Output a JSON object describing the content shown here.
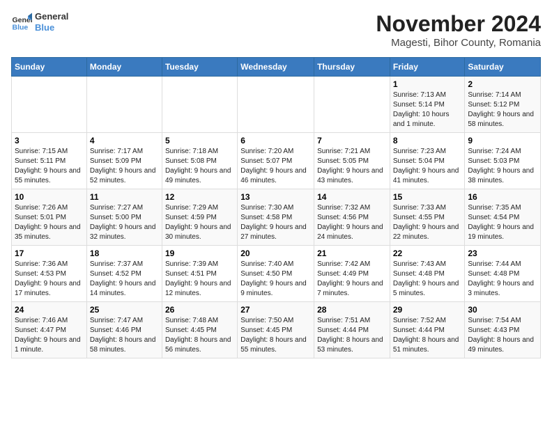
{
  "header": {
    "logo_line1": "General",
    "logo_line2": "Blue",
    "main_title": "November 2024",
    "subtitle": "Magesti, Bihor County, Romania"
  },
  "days_of_week": [
    "Sunday",
    "Monday",
    "Tuesday",
    "Wednesday",
    "Thursday",
    "Friday",
    "Saturday"
  ],
  "weeks": [
    [
      {
        "day": "",
        "info": ""
      },
      {
        "day": "",
        "info": ""
      },
      {
        "day": "",
        "info": ""
      },
      {
        "day": "",
        "info": ""
      },
      {
        "day": "",
        "info": ""
      },
      {
        "day": "1",
        "info": "Sunrise: 7:13 AM\nSunset: 5:14 PM\nDaylight: 10 hours and 1 minute."
      },
      {
        "day": "2",
        "info": "Sunrise: 7:14 AM\nSunset: 5:12 PM\nDaylight: 9 hours and 58 minutes."
      }
    ],
    [
      {
        "day": "3",
        "info": "Sunrise: 7:15 AM\nSunset: 5:11 PM\nDaylight: 9 hours and 55 minutes."
      },
      {
        "day": "4",
        "info": "Sunrise: 7:17 AM\nSunset: 5:09 PM\nDaylight: 9 hours and 52 minutes."
      },
      {
        "day": "5",
        "info": "Sunrise: 7:18 AM\nSunset: 5:08 PM\nDaylight: 9 hours and 49 minutes."
      },
      {
        "day": "6",
        "info": "Sunrise: 7:20 AM\nSunset: 5:07 PM\nDaylight: 9 hours and 46 minutes."
      },
      {
        "day": "7",
        "info": "Sunrise: 7:21 AM\nSunset: 5:05 PM\nDaylight: 9 hours and 43 minutes."
      },
      {
        "day": "8",
        "info": "Sunrise: 7:23 AM\nSunset: 5:04 PM\nDaylight: 9 hours and 41 minutes."
      },
      {
        "day": "9",
        "info": "Sunrise: 7:24 AM\nSunset: 5:03 PM\nDaylight: 9 hours and 38 minutes."
      }
    ],
    [
      {
        "day": "10",
        "info": "Sunrise: 7:26 AM\nSunset: 5:01 PM\nDaylight: 9 hours and 35 minutes."
      },
      {
        "day": "11",
        "info": "Sunrise: 7:27 AM\nSunset: 5:00 PM\nDaylight: 9 hours and 32 minutes."
      },
      {
        "day": "12",
        "info": "Sunrise: 7:29 AM\nSunset: 4:59 PM\nDaylight: 9 hours and 30 minutes."
      },
      {
        "day": "13",
        "info": "Sunrise: 7:30 AM\nSunset: 4:58 PM\nDaylight: 9 hours and 27 minutes."
      },
      {
        "day": "14",
        "info": "Sunrise: 7:32 AM\nSunset: 4:56 PM\nDaylight: 9 hours and 24 minutes."
      },
      {
        "day": "15",
        "info": "Sunrise: 7:33 AM\nSunset: 4:55 PM\nDaylight: 9 hours and 22 minutes."
      },
      {
        "day": "16",
        "info": "Sunrise: 7:35 AM\nSunset: 4:54 PM\nDaylight: 9 hours and 19 minutes."
      }
    ],
    [
      {
        "day": "17",
        "info": "Sunrise: 7:36 AM\nSunset: 4:53 PM\nDaylight: 9 hours and 17 minutes."
      },
      {
        "day": "18",
        "info": "Sunrise: 7:37 AM\nSunset: 4:52 PM\nDaylight: 9 hours and 14 minutes."
      },
      {
        "day": "19",
        "info": "Sunrise: 7:39 AM\nSunset: 4:51 PM\nDaylight: 9 hours and 12 minutes."
      },
      {
        "day": "20",
        "info": "Sunrise: 7:40 AM\nSunset: 4:50 PM\nDaylight: 9 hours and 9 minutes."
      },
      {
        "day": "21",
        "info": "Sunrise: 7:42 AM\nSunset: 4:49 PM\nDaylight: 9 hours and 7 minutes."
      },
      {
        "day": "22",
        "info": "Sunrise: 7:43 AM\nSunset: 4:48 PM\nDaylight: 9 hours and 5 minutes."
      },
      {
        "day": "23",
        "info": "Sunrise: 7:44 AM\nSunset: 4:48 PM\nDaylight: 9 hours and 3 minutes."
      }
    ],
    [
      {
        "day": "24",
        "info": "Sunrise: 7:46 AM\nSunset: 4:47 PM\nDaylight: 9 hours and 1 minute."
      },
      {
        "day": "25",
        "info": "Sunrise: 7:47 AM\nSunset: 4:46 PM\nDaylight: 8 hours and 58 minutes."
      },
      {
        "day": "26",
        "info": "Sunrise: 7:48 AM\nSunset: 4:45 PM\nDaylight: 8 hours and 56 minutes."
      },
      {
        "day": "27",
        "info": "Sunrise: 7:50 AM\nSunset: 4:45 PM\nDaylight: 8 hours and 55 minutes."
      },
      {
        "day": "28",
        "info": "Sunrise: 7:51 AM\nSunset: 4:44 PM\nDaylight: 8 hours and 53 minutes."
      },
      {
        "day": "29",
        "info": "Sunrise: 7:52 AM\nSunset: 4:44 PM\nDaylight: 8 hours and 51 minutes."
      },
      {
        "day": "30",
        "info": "Sunrise: 7:54 AM\nSunset: 4:43 PM\nDaylight: 8 hours and 49 minutes."
      }
    ]
  ]
}
